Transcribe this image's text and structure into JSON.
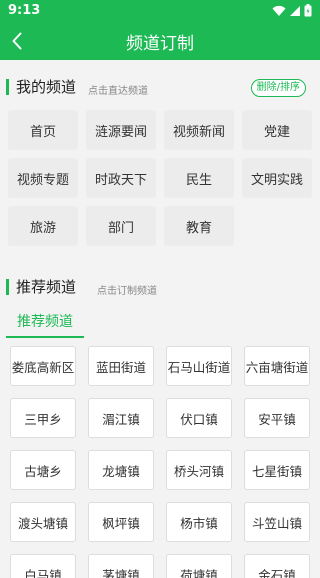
{
  "status": {
    "time": "9:13"
  },
  "header": {
    "title": "频道订制"
  },
  "my_channels": {
    "title": "我的频道",
    "hint": "点击直达频道",
    "edit_label": "删除/排序",
    "items": [
      "首页",
      "涟源要闻",
      "视频新闻",
      "党建",
      "视频专题",
      "时政天下",
      "民生",
      "文明实践",
      "旅游",
      "部门",
      "教育"
    ]
  },
  "recommended": {
    "title": "推荐频道",
    "hint": "点击订制频道",
    "tab_label": "推荐频道",
    "items": [
      "娄底高新区",
      "蓝田街道",
      "石马山街道",
      "六亩塘街道",
      "三甲乡",
      "湄江镇",
      "伏口镇",
      "安平镇",
      "古塘乡",
      "龙塘镇",
      "桥头河镇",
      "七星街镇",
      "渡头塘镇",
      "枫坪镇",
      "杨市镇",
      "斗笠山镇",
      "白马镇",
      "茅塘镇",
      "荷塘镇",
      "金石镇"
    ]
  },
  "colors": {
    "accent": "#1db954"
  }
}
